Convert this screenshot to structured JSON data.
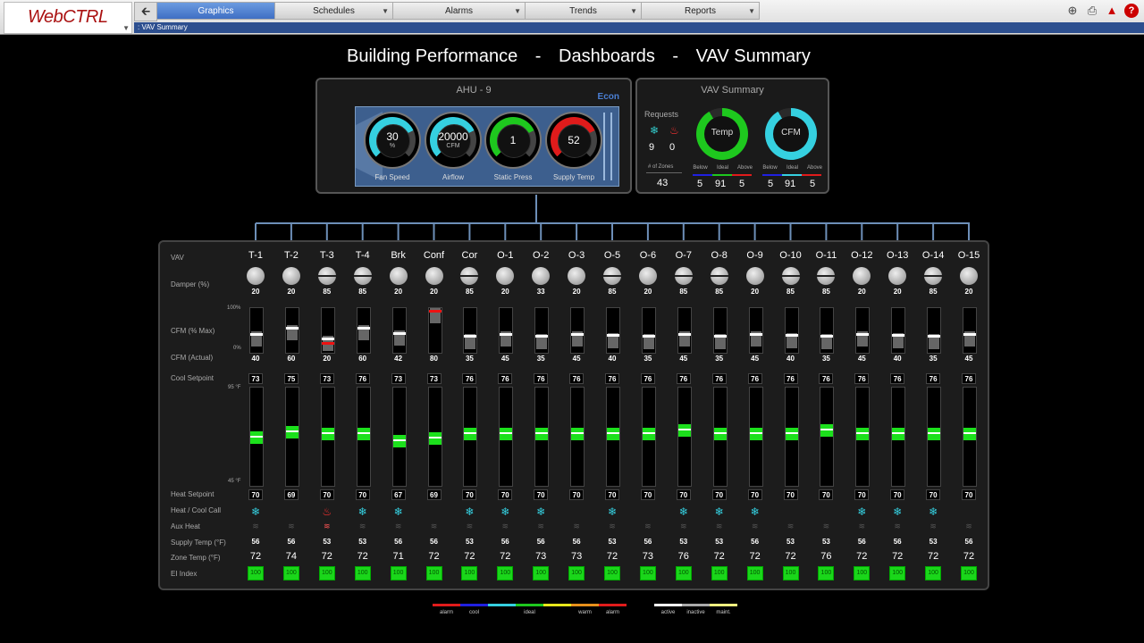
{
  "app": {
    "logo_text": "WebCTRL"
  },
  "nav": {
    "back_label": "🡰",
    "tabs": [
      {
        "label": "Graphics",
        "active": true
      },
      {
        "label": "Schedules",
        "active": false
      },
      {
        "label": "Alarms",
        "active": false
      },
      {
        "label": "Trends",
        "active": false
      },
      {
        "label": "Reports",
        "active": false
      }
    ]
  },
  "breadcrumb": ": VAV Summary",
  "title": {
    "part1": "Building Performance",
    "sep1": "-",
    "part2": "Dashboards",
    "sep2": "-",
    "part3": "VAV Summary"
  },
  "ahu": {
    "title": "AHU - 9",
    "econ": "Econ",
    "gauges": [
      {
        "label": "Fan Speed",
        "value": "30",
        "unit": "%",
        "color": "#35d0e0"
      },
      {
        "label": "Airflow",
        "value": "20000",
        "unit": "CFM",
        "color": "#35d0e0"
      },
      {
        "label": "Static Press",
        "value": "1",
        "unit": "",
        "color": "#1ec81e"
      },
      {
        "label": "Supply Temp",
        "value": "52",
        "unit": "",
        "color": "#e01b1b"
      }
    ]
  },
  "vav_summary": {
    "title": "VAV Summary",
    "requests_label": "Requests",
    "cool_requests": "9",
    "heat_requests": "0",
    "zones_label": "# of Zones",
    "zones": "43",
    "temp_donut": {
      "label": "Temp",
      "below": "5",
      "ideal": "91",
      "above": "5"
    },
    "cfm_donut": {
      "label": "CFM",
      "below": "5",
      "ideal": "91",
      "above": "5"
    },
    "cat_labels": [
      "Below",
      "Ideal",
      "Above"
    ]
  },
  "rows": {
    "vav": "VAV",
    "damper": "Damper (%)",
    "cfm_max": "CFM (% Max)",
    "cfm_100": "100%",
    "cfm_0": "0%",
    "cfm_actual": "CFM (Actual)",
    "cool_sp": "Cool Setpoint",
    "t95": "95 °F",
    "t45": "45 °F",
    "heat_sp": "Heat Setpoint",
    "call": "Heat / Cool Call",
    "aux": "Aux Heat",
    "supply": "Supply Temp (°F)",
    "zone": "Zone Temp (°F)",
    "ei": "EI Index"
  },
  "vavs": [
    {
      "name": "T-1",
      "damper": "20",
      "cfm_pct": 25,
      "cfm": "40",
      "cool": "73",
      "heat": "70",
      "temp_pct": 48,
      "call": "cool",
      "aux": false,
      "supply": "56",
      "zone": "72",
      "ei": "100"
    },
    {
      "name": "T-2",
      "damper": "20",
      "cfm_pct": 40,
      "cfm": "60",
      "cool": "75",
      "heat": "69",
      "temp_pct": 54,
      "call": "none",
      "aux": false,
      "supply": "56",
      "zone": "74",
      "ei": "100"
    },
    {
      "name": "T-3",
      "damper": "85",
      "cfm_pct": 15,
      "cfm": "20",
      "cool": "73",
      "heat": "70",
      "temp_pct": 52,
      "call": "heat",
      "aux": true,
      "supply": "53",
      "zone": "72",
      "ei": "100"
    },
    {
      "name": "T-4",
      "damper": "85",
      "cfm_pct": 40,
      "cfm": "60",
      "cool": "76",
      "heat": "70",
      "temp_pct": 52,
      "call": "cool",
      "aux": false,
      "supply": "53",
      "zone": "72",
      "ei": "100"
    },
    {
      "name": "Brk",
      "damper": "20",
      "cfm_pct": 28,
      "cfm": "42",
      "cool": "73",
      "heat": "67",
      "temp_pct": 44,
      "call": "cool",
      "aux": false,
      "supply": "56",
      "zone": "71",
      "ei": "100"
    },
    {
      "name": "Conf",
      "damper": "20",
      "cfm_pct": 95,
      "cfm": "80",
      "cool": "73",
      "heat": "69",
      "temp_pct": 47,
      "call": "none",
      "aux": false,
      "supply": "56",
      "zone": "72",
      "ei": "100"
    },
    {
      "name": "Cor",
      "damper": "85",
      "cfm_pct": 20,
      "cfm": "35",
      "cool": "76",
      "heat": "70",
      "temp_pct": 52,
      "call": "cool",
      "aux": false,
      "supply": "53",
      "zone": "72",
      "ei": "100"
    },
    {
      "name": "O-1",
      "damper": "20",
      "cfm_pct": 25,
      "cfm": "45",
      "cool": "76",
      "heat": "70",
      "temp_pct": 52,
      "call": "cool",
      "aux": false,
      "supply": "56",
      "zone": "72",
      "ei": "100"
    },
    {
      "name": "O-2",
      "damper": "33",
      "cfm_pct": 20,
      "cfm": "35",
      "cool": "76",
      "heat": "70",
      "temp_pct": 52,
      "call": "cool",
      "aux": false,
      "supply": "56",
      "zone": "73",
      "ei": "100"
    },
    {
      "name": "O-3",
      "damper": "20",
      "cfm_pct": 25,
      "cfm": "45",
      "cool": "76",
      "heat": "70",
      "temp_pct": 52,
      "call": "none",
      "aux": false,
      "supply": "56",
      "zone": "73",
      "ei": "100"
    },
    {
      "name": "O-5",
      "damper": "85",
      "cfm_pct": 22,
      "cfm": "40",
      "cool": "76",
      "heat": "70",
      "temp_pct": 52,
      "call": "cool",
      "aux": false,
      "supply": "53",
      "zone": "72",
      "ei": "100"
    },
    {
      "name": "O-6",
      "damper": "20",
      "cfm_pct": 20,
      "cfm": "35",
      "cool": "76",
      "heat": "70",
      "temp_pct": 52,
      "call": "none",
      "aux": false,
      "supply": "56",
      "zone": "73",
      "ei": "100"
    },
    {
      "name": "O-7",
      "damper": "85",
      "cfm_pct": 25,
      "cfm": "45",
      "cool": "76",
      "heat": "70",
      "temp_pct": 56,
      "call": "cool",
      "aux": false,
      "supply": "53",
      "zone": "76",
      "ei": "100"
    },
    {
      "name": "O-8",
      "damper": "85",
      "cfm_pct": 20,
      "cfm": "35",
      "cool": "76",
      "heat": "70",
      "temp_pct": 52,
      "call": "cool",
      "aux": false,
      "supply": "53",
      "zone": "72",
      "ei": "100"
    },
    {
      "name": "O-9",
      "damper": "20",
      "cfm_pct": 25,
      "cfm": "45",
      "cool": "76",
      "heat": "70",
      "temp_pct": 52,
      "call": "cool",
      "aux": false,
      "supply": "56",
      "zone": "72",
      "ei": "100"
    },
    {
      "name": "O-10",
      "damper": "85",
      "cfm_pct": 22,
      "cfm": "40",
      "cool": "76",
      "heat": "70",
      "temp_pct": 52,
      "call": "none",
      "aux": false,
      "supply": "53",
      "zone": "72",
      "ei": "100"
    },
    {
      "name": "O-11",
      "damper": "85",
      "cfm_pct": 20,
      "cfm": "35",
      "cool": "76",
      "heat": "70",
      "temp_pct": 56,
      "call": "none",
      "aux": false,
      "supply": "53",
      "zone": "76",
      "ei": "100"
    },
    {
      "name": "O-12",
      "damper": "20",
      "cfm_pct": 25,
      "cfm": "45",
      "cool": "76",
      "heat": "70",
      "temp_pct": 52,
      "call": "cool",
      "aux": false,
      "supply": "56",
      "zone": "72",
      "ei": "100"
    },
    {
      "name": "O-13",
      "damper": "20",
      "cfm_pct": 22,
      "cfm": "40",
      "cool": "76",
      "heat": "70",
      "temp_pct": 52,
      "call": "cool",
      "aux": false,
      "supply": "56",
      "zone": "72",
      "ei": "100"
    },
    {
      "name": "O-14",
      "damper": "85",
      "cfm_pct": 20,
      "cfm": "35",
      "cool": "76",
      "heat": "70",
      "temp_pct": 52,
      "call": "cool",
      "aux": false,
      "supply": "53",
      "zone": "72",
      "ei": "100"
    },
    {
      "name": "O-15",
      "damper": "20",
      "cfm_pct": 25,
      "cfm": "45",
      "cool": "76",
      "heat": "70",
      "temp_pct": 52,
      "call": "none",
      "aux": false,
      "supply": "56",
      "zone": "72",
      "ei": "100"
    }
  ],
  "legend": [
    {
      "label": "alarm",
      "color": "#e01b1b"
    },
    {
      "label": "cool",
      "color": "#2020e0"
    },
    {
      "label": "",
      "color": "#35d0e0"
    },
    {
      "label": "ideal",
      "color": "#1ec81e"
    },
    {
      "label": "",
      "color": "#e8e81b"
    },
    {
      "label": "warm",
      "color": "#e8901b"
    },
    {
      "label": "alarm",
      "color": "#e01b1b"
    },
    {
      "label": "",
      "color": "#000000"
    },
    {
      "label": "active",
      "color": "#ffffff"
    },
    {
      "label": "inactive",
      "color": "#aaaaaa"
    },
    {
      "label": "maint.",
      "color": "#f0f080"
    }
  ],
  "colors": {
    "cool_call": "#35d0e0",
    "heat_call": "#ff3030"
  }
}
